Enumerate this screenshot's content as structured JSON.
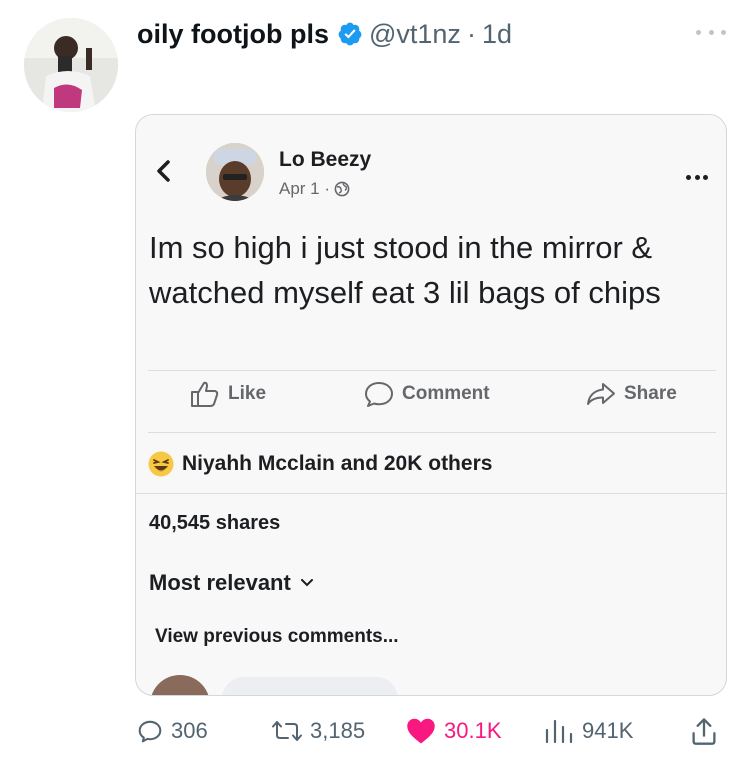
{
  "tweet": {
    "display_name": "oily footjob pls",
    "handle": "@vt1nz",
    "separator": "·",
    "time": "1d"
  },
  "embedded_post": {
    "poster_name": "Lo Beezy",
    "date": "Apr 1 ·",
    "text": "Im so high i just stood in the mirror & watched myself eat 3 lil bags of chips",
    "actions": {
      "like": "Like",
      "comment": "Comment",
      "share": "Share"
    },
    "reactions_text": "Niyahh Mcclain and 20K others",
    "shares_text": "40,545 shares",
    "sort_label": "Most relevant",
    "view_previous": "View previous comments..."
  },
  "stats": {
    "replies": "306",
    "retweets": "3,185",
    "likes": "30.1K",
    "views": "941K"
  },
  "colors": {
    "verified": "#1d9bf0",
    "like": "#f91880",
    "muted": "#536471"
  }
}
